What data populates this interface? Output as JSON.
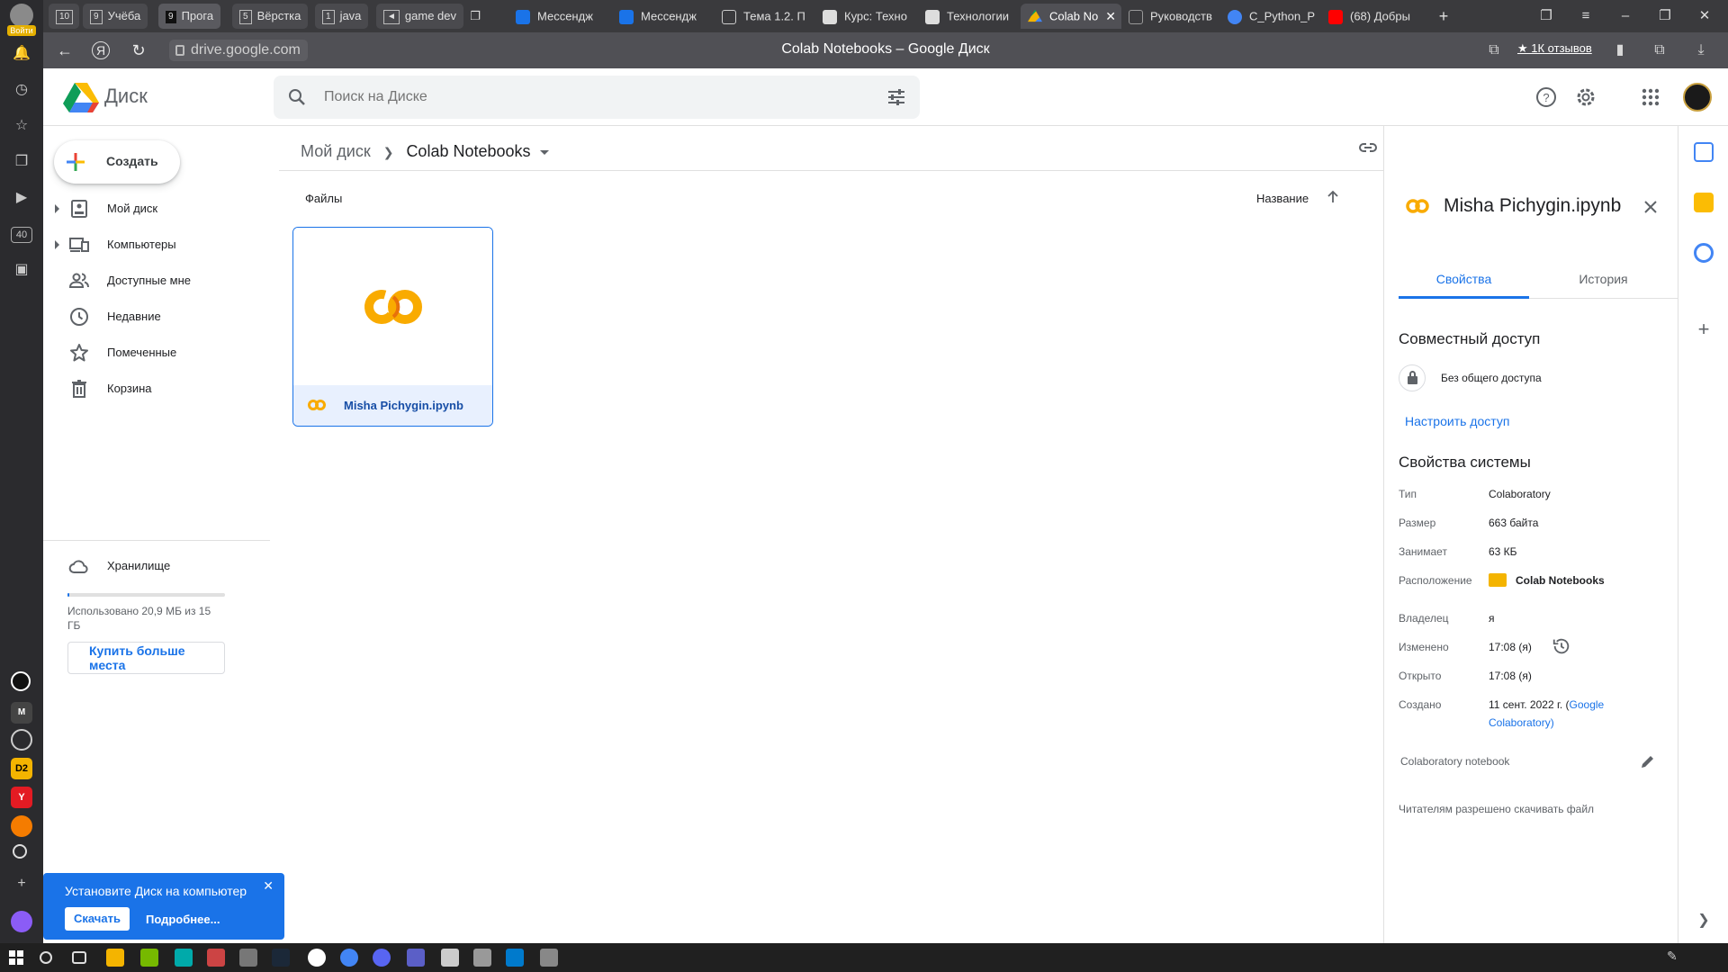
{
  "browser": {
    "login_label": "Войти",
    "tabs": [
      {
        "label": "10",
        "kind": "group"
      },
      {
        "label": "Учёба",
        "num": "9",
        "kind": "group"
      },
      {
        "label": "Прога",
        "num": "9",
        "kind": "group"
      },
      {
        "label": "Вёрстка",
        "num": "5",
        "kind": "group"
      },
      {
        "label": "java",
        "num": "1",
        "kind": "group"
      },
      {
        "label": "game dev",
        "kind": "group"
      },
      {
        "label": "Мессендж",
        "kind": "tab"
      },
      {
        "label": "Мессендж",
        "kind": "tab"
      },
      {
        "label": "Тема 1.2. П",
        "kind": "tab"
      },
      {
        "label": "Курс: Техно",
        "kind": "tab"
      },
      {
        "label": "Технологии",
        "kind": "tab"
      },
      {
        "label": "Colab No",
        "kind": "tab",
        "active": true
      },
      {
        "label": "Руководств",
        "kind": "tab"
      },
      {
        "label": "C_Python_P",
        "kind": "tab"
      },
      {
        "label": "(68) Добры",
        "kind": "tab"
      }
    ],
    "url": "drive.google.com",
    "page_title": "Colab Notebooks – Google Диск",
    "reviews": "★ 1К отзывов",
    "sidebar_count": "40"
  },
  "drive": {
    "app_name": "Диск",
    "search_placeholder": "Поиск на Диске",
    "create_label": "Создать",
    "nav": [
      {
        "label": "Мой диск",
        "icon": "my-drive-icon",
        "expandable": true
      },
      {
        "label": "Компьютеры",
        "icon": "computers-icon",
        "expandable": true
      },
      {
        "label": "Доступные мне",
        "icon": "shared-icon",
        "expandable": false
      },
      {
        "label": "Недавние",
        "icon": "clock-icon",
        "expandable": false
      },
      {
        "label": "Помеченные",
        "icon": "star-icon",
        "expandable": false
      },
      {
        "label": "Корзина",
        "icon": "trash-icon",
        "expandable": false
      }
    ],
    "storage": {
      "label": "Хранилище",
      "used_text": "Использовано 20,9 МБ из 15 ГБ",
      "buy_more": "Купить больше места",
      "used_fraction": 0.0014
    },
    "toast": {
      "title": "Установите Диск на компьютер",
      "download": "Скачать",
      "more": "Подробнее..."
    },
    "breadcrumb": {
      "root": "Мой диск",
      "current": "Colab Notebooks"
    },
    "section_files": "Файлы",
    "sort_label": "Название",
    "file": {
      "name": "Misha Pichygin.ipynb"
    }
  },
  "details": {
    "title": "Misha Pichygin.ipynb",
    "tab_properties": "Свойства",
    "tab_history": "История",
    "sharing_header": "Совместный доступ",
    "sharing_state": "Без общего доступа",
    "configure_access": "Настроить доступ",
    "system_header": "Свойства системы",
    "props": {
      "type_k": "Тип",
      "type_v": "Colaboratory",
      "size_k": "Размер",
      "size_v": "663 байта",
      "used_k": "Занимает",
      "used_v": "63 КБ",
      "loc_k": "Расположение",
      "loc_v": "Colab Notebooks",
      "owner_k": "Владелец",
      "owner_v": "я",
      "mod_k": "Изменено",
      "mod_v": "17:08 (я)",
      "opened_k": "Открыто",
      "opened_v": "17:08 (я)",
      "created_k": "Создано",
      "created_v": "11 сент. 2022 г. (",
      "created_link": "Google Colaboratory",
      "created_end": ")"
    },
    "description": "Colaboratory notebook",
    "download_permission": "Читателям разрешено скачивать файл"
  },
  "colors": {
    "accent": "#1a73e8",
    "colab_orange": "#f9ab00",
    "colab_yellow": "#e8710a",
    "browser_dark": "#3a3a3d"
  }
}
